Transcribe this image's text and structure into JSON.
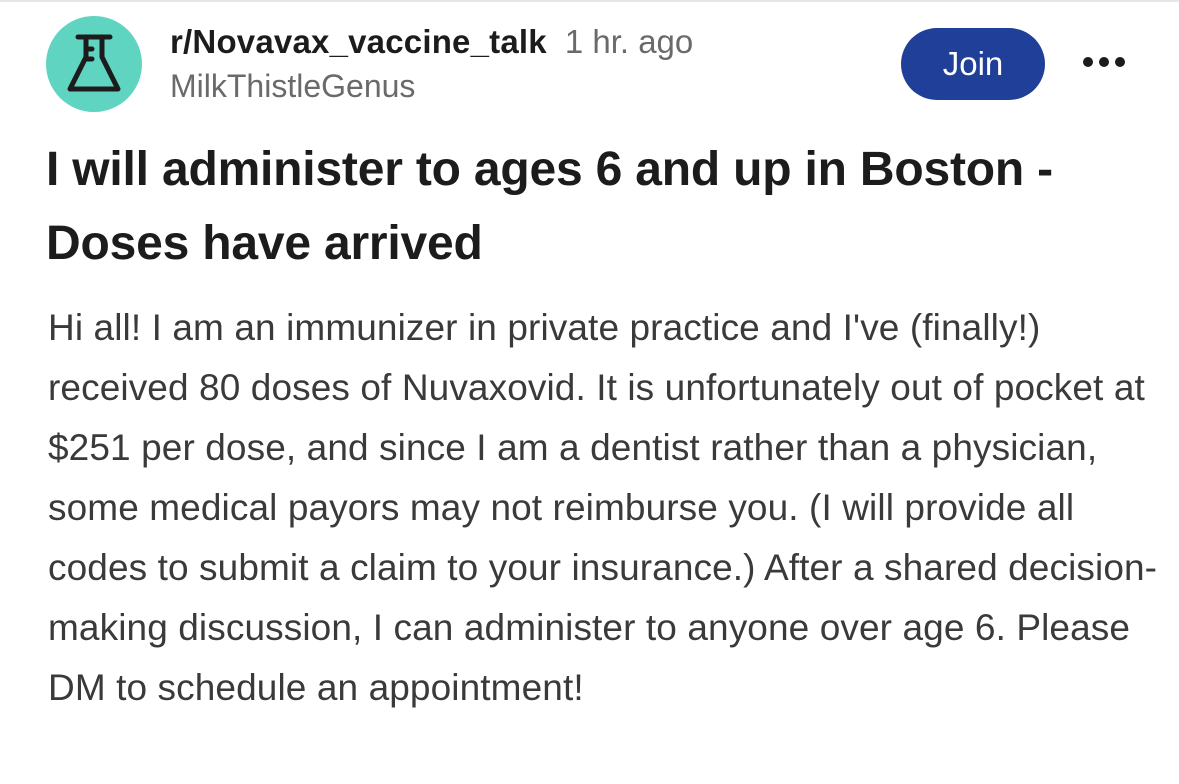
{
  "post": {
    "subreddit": "r/Novavax_vaccine_talk",
    "time_ago": "1 hr. ago",
    "username": "MilkThistleGenus",
    "join_label": "Join",
    "more_icon": "more-horizontal-icon",
    "avatar_icon": "flask-icon",
    "title": "I will administer to ages 6 and up in Boston - Doses have arrived",
    "body": "Hi all! I am an immunizer in private practice and I've (finally!) received 80 doses of Nuvaxovid. It is unfortunately out of pocket at $251 per dose, and since I am a dentist rather than a physician, some medical payors may not reimburse you. (I will provide all codes to submit a claim to your insurance.) After a shared decision-making discussion, I can administer to anyone over age 6. Please DM to schedule an appointment!"
  },
  "colors": {
    "avatar_bg": "#5fd4c0",
    "join_bg": "#1f3f99",
    "text_primary": "#1c1c1c",
    "text_secondary": "#6a6a6a",
    "body_text": "#3a3a3a"
  }
}
